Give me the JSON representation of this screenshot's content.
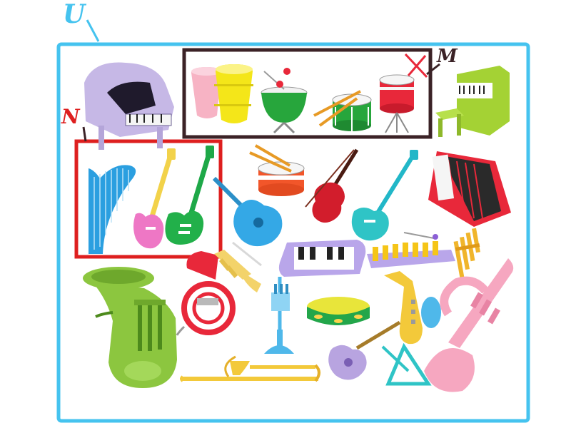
{
  "diagram": {
    "universal_set": {
      "label": "U",
      "color": "#45c3ef"
    },
    "set_m": {
      "label": "M",
      "color": "#3b2226",
      "members": [
        "conga-drums-icon",
        "timpani-icon",
        "snare-drum-with-sticks-icon",
        "drum-on-stand-icon"
      ]
    },
    "set_n": {
      "label": "N",
      "color": "#de1f1f",
      "members": [
        "harp-icon",
        "electric-guitar-pink-icon",
        "electric-guitar-green-icon"
      ]
    },
    "other_elements": [
      "grand-piano-icon",
      "upright-piano-icon",
      "snare-drum-icon",
      "acoustic-guitar-icon",
      "violin-icon",
      "electric-guitar-teal-icon",
      "accordion-icon",
      "keyboard-icon",
      "xylophone-icon",
      "pan-flute-icon",
      "tuba-icon",
      "french-horn-icon",
      "trumpet-icon",
      "cornet-icon",
      "tambourine-icon",
      "saxophone-icon",
      "trombone-icon",
      "ukulele-icon",
      "triangle-icon",
      "pink-trumpet-icon"
    ]
  }
}
